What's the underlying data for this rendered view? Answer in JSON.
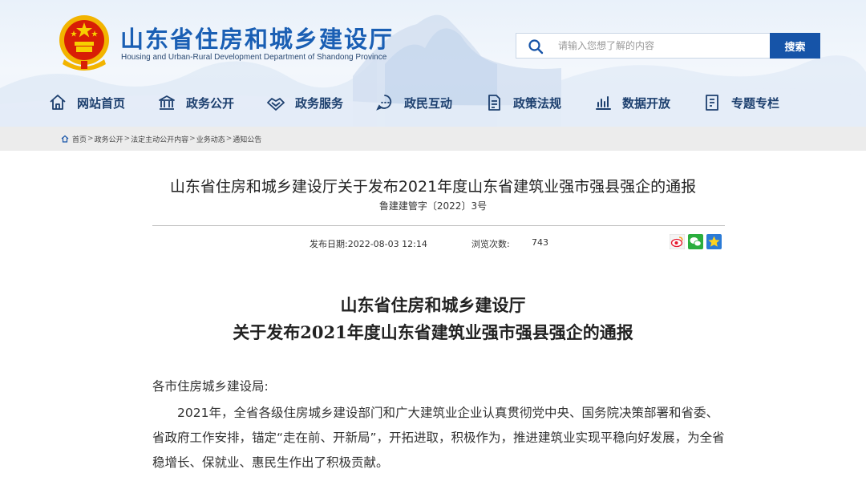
{
  "header": {
    "site_title": "山东省住房和城乡建设厅",
    "site_subtitle": "Housing and Urban-Rural Development Department of Shandong Province",
    "search_placeholder": "请输入您想了解的内容",
    "search_button": "搜索",
    "accent_color": "#1654a8"
  },
  "nav": {
    "items": [
      {
        "label": "网站首页",
        "icon": "home-icon"
      },
      {
        "label": "政务公开",
        "icon": "government-building-icon"
      },
      {
        "label": "政务服务",
        "icon": "handshake-icon"
      },
      {
        "label": "政民互动",
        "icon": "interaction-icon"
      },
      {
        "label": "政策法规",
        "icon": "policy-document-icon"
      },
      {
        "label": "数据开放",
        "icon": "data-chart-icon"
      },
      {
        "label": "专题专栏",
        "icon": "topic-icon"
      }
    ]
  },
  "breadcrumb": {
    "items": [
      "首页",
      "政务公开",
      "法定主动公开内容",
      "业务动态",
      "通知公告"
    ],
    "separator": ">"
  },
  "article": {
    "title": "山东省住房和城乡建设厅关于发布2021年度山东省建筑业强市强县强企的通报",
    "doc_number": "鲁建建管字〔2022〕3号",
    "publish_date": "发布日期:2022-08-03 12:14",
    "views_label": "浏览次数:",
    "views_count": "743",
    "share_icons": [
      "weibo-share-icon",
      "wechat-share-icon",
      "favorite-star-icon"
    ],
    "doc_heading_line1": "山东省住房和城乡建设厅",
    "doc_heading_line2": "关于发布2021年度山东省建筑业强市强县强企的通报",
    "salutation": "各市住房城乡建设局:",
    "body_paragraph": "2021年，全省各级住房城乡建设部门和广大建筑业企业认真贯彻党中央、国务院决策部署和省委、省政府工作安排，锚定“走在前、开新局”，开拓进取，积极作为，推进建筑业实现平稳向好发展，为全省稳增长、保就业、惠民生作出了积极贡献。"
  }
}
